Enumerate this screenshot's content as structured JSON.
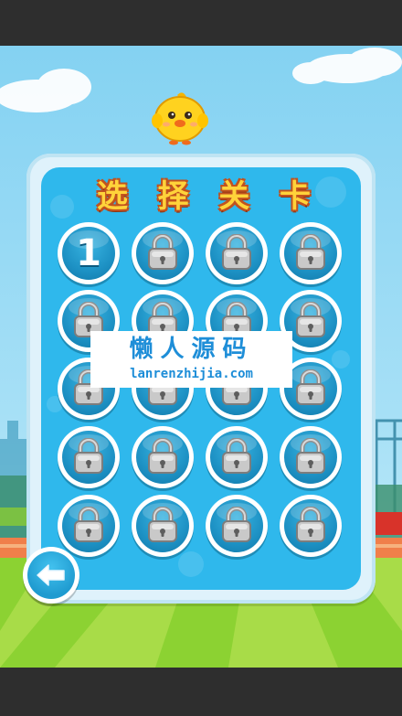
{
  "screen": {
    "title_chars": [
      "选",
      "择",
      "关",
      "卡"
    ]
  },
  "levels": [
    {
      "label": "1",
      "state": "unlocked"
    },
    {
      "label": "",
      "state": "locked"
    },
    {
      "label": "",
      "state": "locked"
    },
    {
      "label": "",
      "state": "locked"
    },
    {
      "label": "",
      "state": "locked"
    },
    {
      "label": "",
      "state": "locked"
    },
    {
      "label": "",
      "state": "locked"
    },
    {
      "label": "",
      "state": "locked"
    },
    {
      "label": "",
      "state": "locked"
    },
    {
      "label": "",
      "state": "locked"
    },
    {
      "label": "",
      "state": "locked"
    },
    {
      "label": "",
      "state": "locked"
    },
    {
      "label": "",
      "state": "locked"
    },
    {
      "label": "",
      "state": "locked"
    },
    {
      "label": "",
      "state": "locked"
    },
    {
      "label": "",
      "state": "locked"
    },
    {
      "label": "",
      "state": "locked"
    },
    {
      "label": "",
      "state": "locked"
    },
    {
      "label": "",
      "state": "locked"
    },
    {
      "label": "",
      "state": "locked"
    }
  ],
  "watermark": {
    "name": "懒人源码",
    "url": "lanrenzhijia.com"
  },
  "icons": {
    "mascot": "chick-icon",
    "lock": "padlock-icon",
    "back": "back-arrow-icon"
  },
  "colors": {
    "panel": "#2fb8ec",
    "title_fill": "#ffd33a",
    "title_outline": "#c0521f",
    "grass": "#8cd232"
  }
}
